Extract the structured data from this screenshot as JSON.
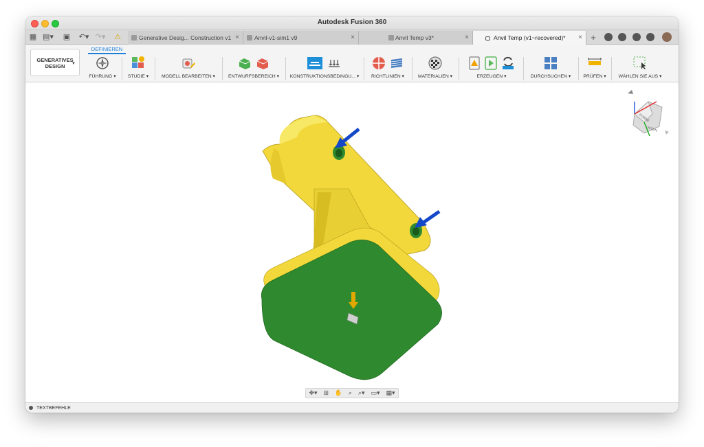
{
  "app": {
    "title": "Autodesk Fusion 360"
  },
  "tabs": [
    {
      "label": "Generative Desig... Construction v1",
      "active": false
    },
    {
      "label": "Anvil-v1-sim1 v9",
      "active": false
    },
    {
      "label": "Anvil Temp v3*",
      "active": false
    },
    {
      "label": "Anvil Temp (v1~recovered)*",
      "active": true
    }
  ],
  "ribbon": {
    "workspace_line1": "GENERATIVES",
    "workspace_line2": "DESIGN",
    "active_tab": "DEFINIEREN",
    "groups": [
      {
        "label": "FÜHRUNG ▾"
      },
      {
        "label": "STUDIE ▾"
      },
      {
        "label": "MODELL BEARBEITEN ▾"
      },
      {
        "label": "ENTWURFSBEREICH ▾"
      },
      {
        "label": "KONSTRUKTIONSBEDINGU... ▾"
      },
      {
        "label": "RICHTLINIEN ▾"
      },
      {
        "label": "MATERIALIEN ▾"
      },
      {
        "label": "ERZEUGEN ▾"
      },
      {
        "label": "DURCHSUCHEN ▾"
      },
      {
        "label": "PRÜFEN ▾"
      },
      {
        "label": "WÄHLEN SIE AUS ▾"
      }
    ]
  },
  "viewcube": {
    "front_label": "FORNE",
    "bottom_label": "UNTEN"
  },
  "statusbar": {
    "label": "TEXTBEFEHLE"
  },
  "colors": {
    "part_yellow": "#f5e04a",
    "face_green": "#2f8a2f",
    "arrow_blue": "#1448c8",
    "accent": "#1d7fd8"
  }
}
